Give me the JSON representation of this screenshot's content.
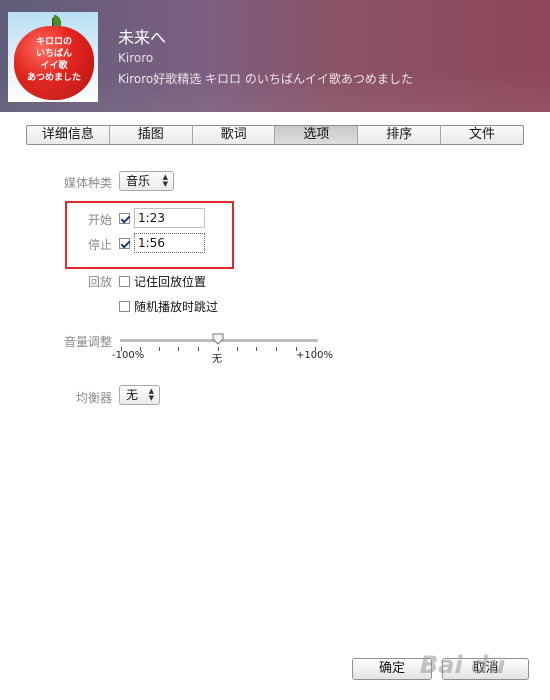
{
  "header": {
    "song_title": "未来へ",
    "artist": "Kiroro",
    "album": "Kiroro好歌精选 キロロ のいちばんイイ歌あつめました",
    "artwork_text": [
      "キロロの",
      "いちばん",
      "イイ歌",
      "あつめました"
    ]
  },
  "tabs": [
    {
      "label": "详细信息",
      "active": false
    },
    {
      "label": "插图",
      "active": false
    },
    {
      "label": "歌词",
      "active": false
    },
    {
      "label": "选项",
      "active": true
    },
    {
      "label": "排序",
      "active": false
    },
    {
      "label": "文件",
      "active": false
    }
  ],
  "form": {
    "media_kind": {
      "label": "媒体种类",
      "value": "音乐"
    },
    "start": {
      "label": "开始",
      "checked": true,
      "value": "1:23"
    },
    "stop": {
      "label": "停止",
      "checked": true,
      "value": "1:56"
    },
    "playback": {
      "label": "回放",
      "remember_position": {
        "label": "记住回放位置",
        "checked": false
      },
      "skip_when_shuffling": {
        "label": "随机播放时跳过",
        "checked": false
      }
    },
    "volume": {
      "label": "音量调整",
      "min_label": "-100%",
      "mid_label": "无",
      "max_label": "+100%",
      "value_percent": 0
    },
    "equalizer": {
      "label": "均衡器",
      "value": "无"
    }
  },
  "buttons": {
    "ok": "确定",
    "cancel": "取消"
  },
  "watermark": "Bai du",
  "colors": {
    "highlight_box": "#e22b2b",
    "header_start": "#5f5d78",
    "header_end": "#8f485a"
  }
}
